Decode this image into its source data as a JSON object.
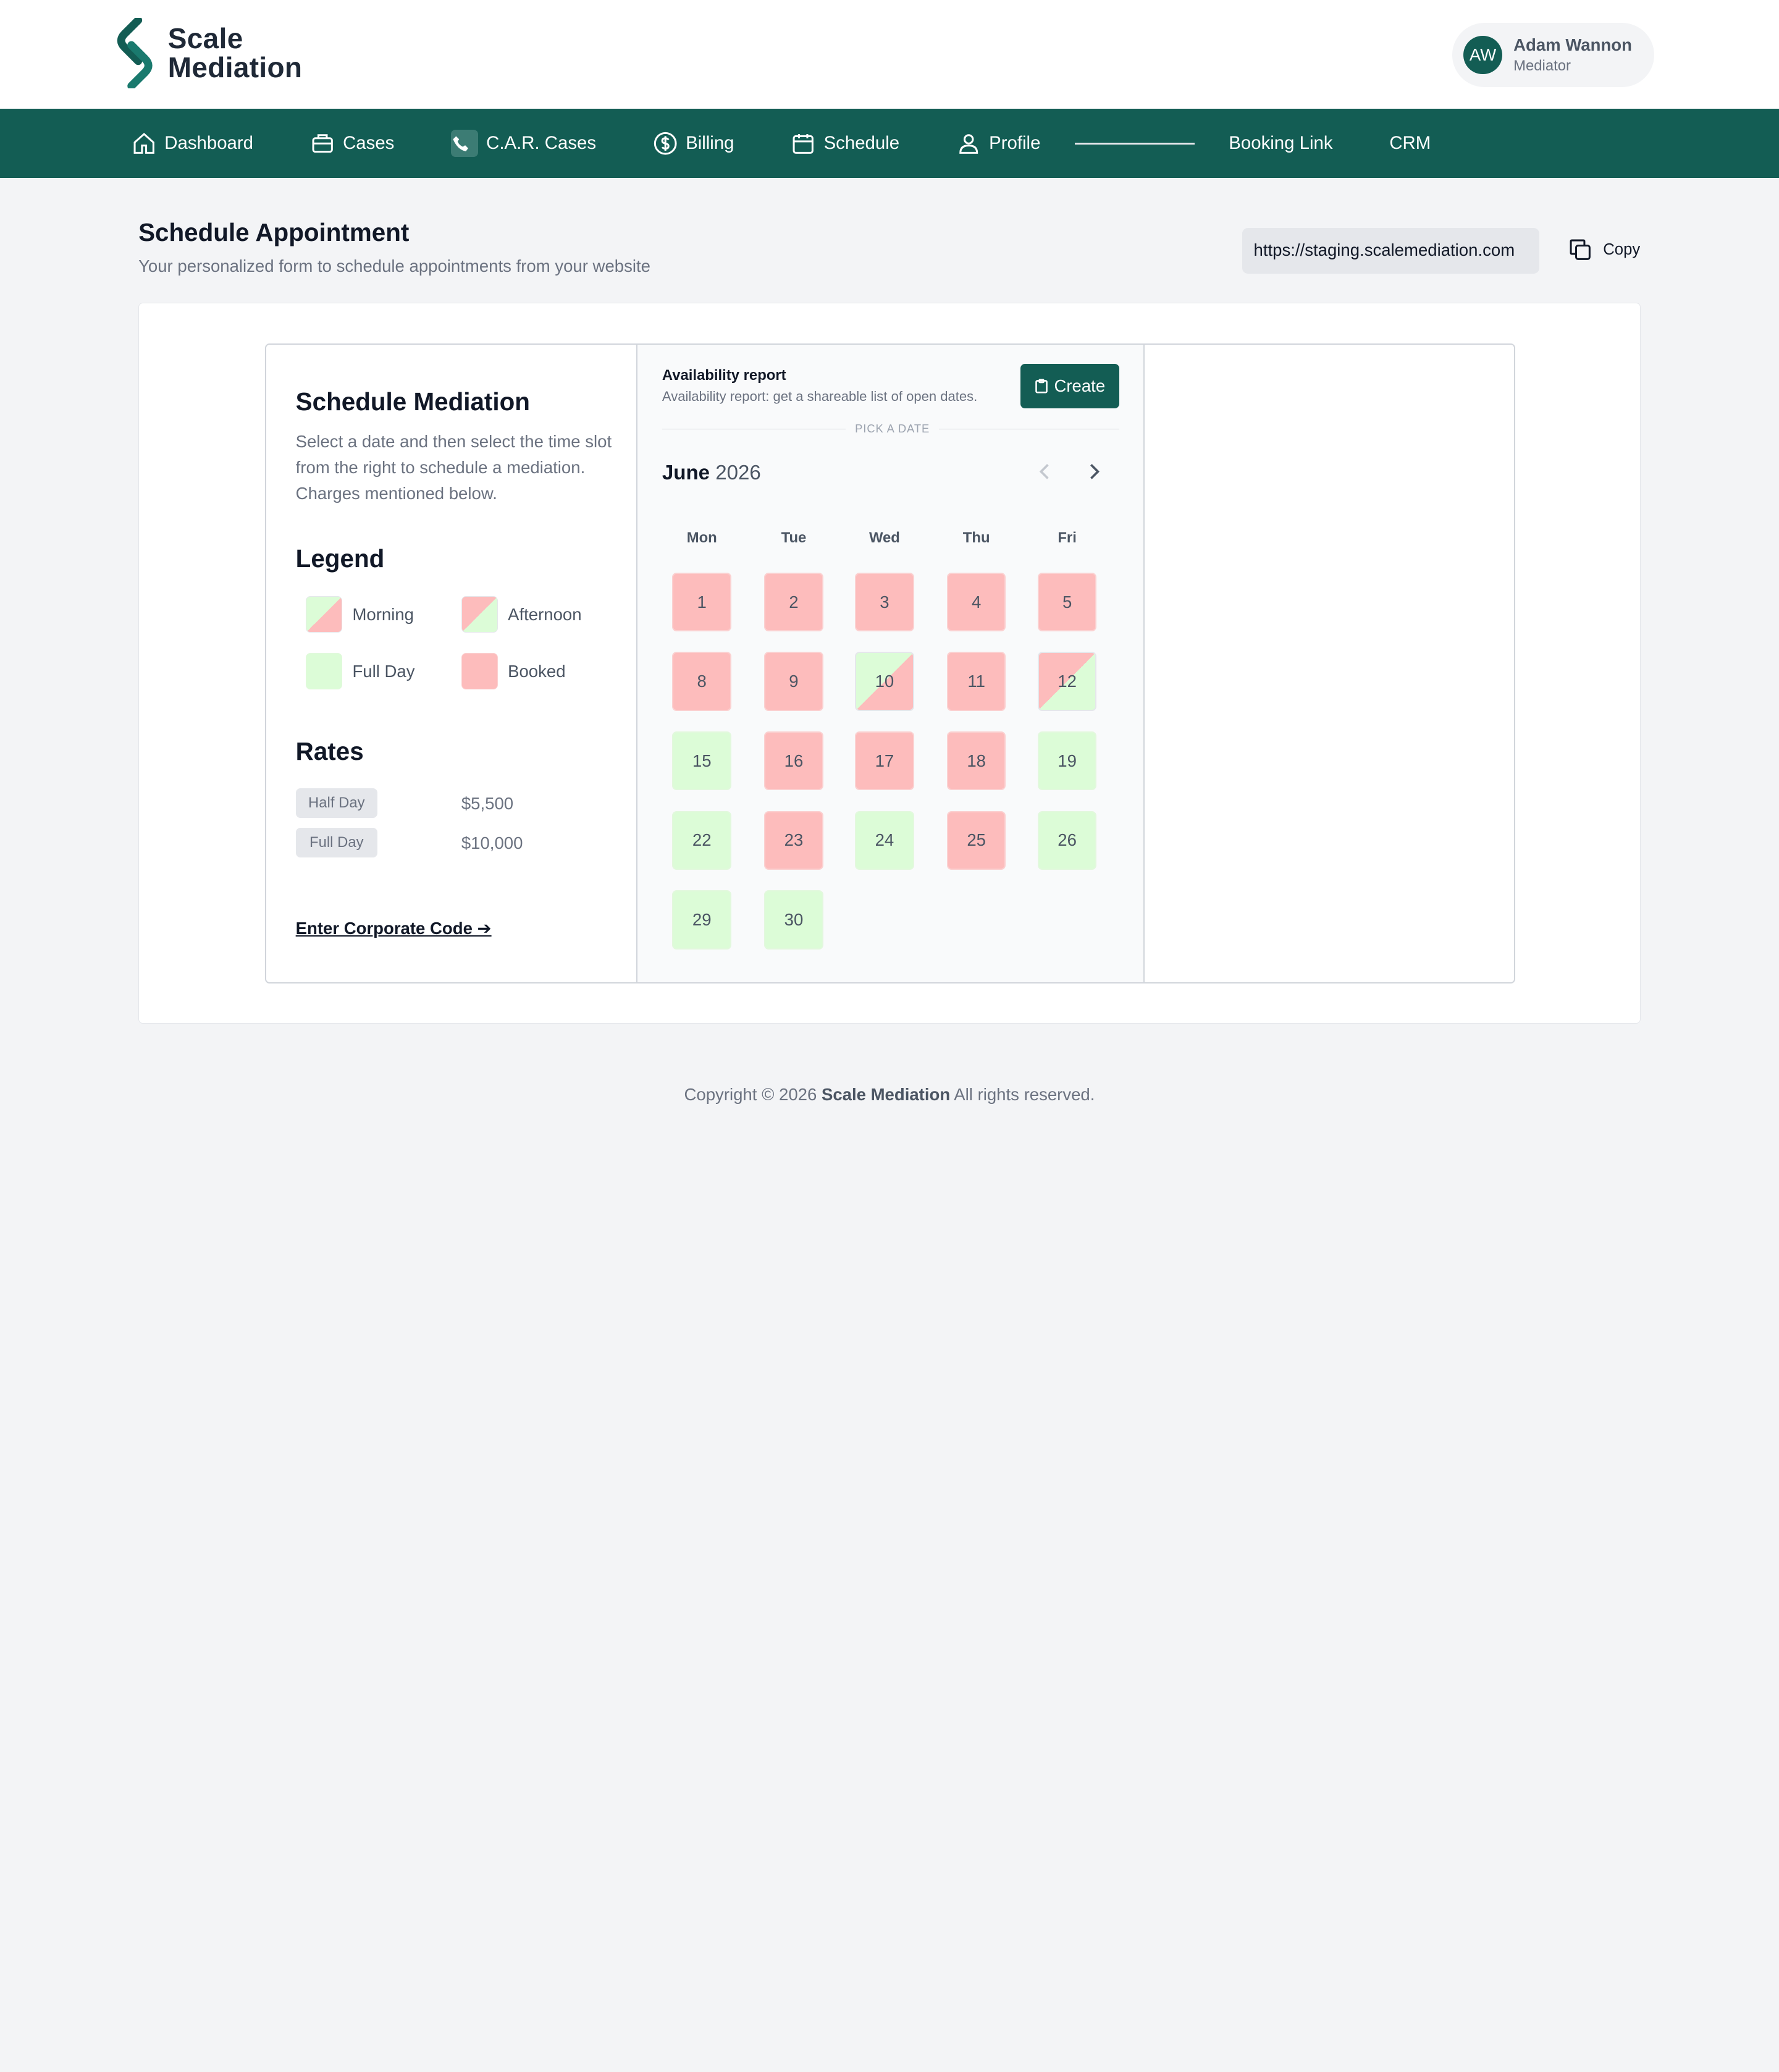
{
  "brand": {
    "line1": "Scale",
    "line2": "Mediation"
  },
  "user": {
    "initials": "AW",
    "name": "Adam Wannon",
    "role": "Mediator"
  },
  "nav": {
    "dashboard": "Dashboard",
    "cases": "Cases",
    "car_cases": "C.A.R. Cases",
    "billing": "Billing",
    "schedule": "Schedule",
    "profile": "Profile",
    "booking_link": "Booking Link",
    "crm": "CRM"
  },
  "header": {
    "title": "Schedule Appointment",
    "subtitle": "Your personalized form to schedule appointments from your website",
    "url": "https://staging.scalemediation.com",
    "copy_label": "Copy"
  },
  "left": {
    "title": "Schedule Mediation",
    "description": "Select a date and then select the time slot from the right to schedule a mediation. Charges mentioned below.",
    "legend_title": "Legend",
    "legend": {
      "morning": "Morning",
      "afternoon": "Afternoon",
      "full_day": "Full Day",
      "booked": "Booked"
    },
    "rates_title": "Rates",
    "rates": [
      {
        "label": "Half Day",
        "value": "$5,500"
      },
      {
        "label": "Full Day",
        "value": "$10,000"
      }
    ],
    "corporate_link": "Enter Corporate Code ➔"
  },
  "calendar": {
    "report_title": "Availability report",
    "report_desc": "Availability report: get a shareable list of open dates.",
    "create_label": "Create",
    "pick_label": "PICK A DATE",
    "month": "June",
    "year": "2026",
    "weekdays": [
      "Mon",
      "Tue",
      "Wed",
      "Thu",
      "Fri"
    ],
    "days": [
      {
        "d": "1",
        "s": "booked"
      },
      {
        "d": "2",
        "s": "booked"
      },
      {
        "d": "3",
        "s": "booked"
      },
      {
        "d": "4",
        "s": "booked"
      },
      {
        "d": "5",
        "s": "booked"
      },
      {
        "d": "8",
        "s": "booked"
      },
      {
        "d": "9",
        "s": "booked"
      },
      {
        "d": "10",
        "s": "morning"
      },
      {
        "d": "11",
        "s": "booked"
      },
      {
        "d": "12",
        "s": "afternoon"
      },
      {
        "d": "15",
        "s": "free"
      },
      {
        "d": "16",
        "s": "booked"
      },
      {
        "d": "17",
        "s": "booked"
      },
      {
        "d": "18",
        "s": "booked"
      },
      {
        "d": "19",
        "s": "free"
      },
      {
        "d": "22",
        "s": "free"
      },
      {
        "d": "23",
        "s": "booked"
      },
      {
        "d": "24",
        "s": "free"
      },
      {
        "d": "25",
        "s": "booked"
      },
      {
        "d": "26",
        "s": "free"
      },
      {
        "d": "29",
        "s": "free"
      },
      {
        "d": "30",
        "s": "free"
      }
    ]
  },
  "footer": {
    "prefix": "Copyright © 2026",
    "brand": "Scale Mediation",
    "suffix": "All rights reserved."
  },
  "colors": {
    "primary": "#135d54",
    "booked": "#fdbcbc",
    "free": "#dcfcd7"
  }
}
